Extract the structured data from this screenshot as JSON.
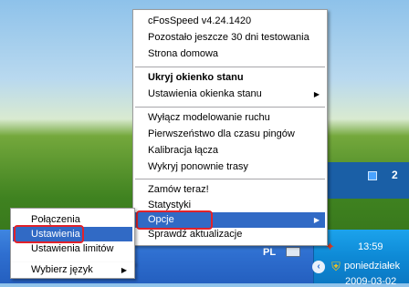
{
  "desktop": {
    "window_count": "2"
  },
  "main_menu": {
    "items": [
      {
        "label": "cFosSpeed v4.24.1420"
      },
      {
        "label": "Pozostało jeszcze 30 dni testowania"
      },
      {
        "label": "Strona domowa"
      },
      {
        "label": "Ukryj okienko stanu"
      },
      {
        "label": "Ustawienia okienka stanu"
      },
      {
        "label": "Wyłącz modelowanie ruchu"
      },
      {
        "label": "Pierwszeństwo dla czasu pingów"
      },
      {
        "label": "Kalibracja łącza"
      },
      {
        "label": "Wykryj ponownie trasy"
      },
      {
        "label": "Zamów teraz!"
      },
      {
        "label": "Statystyki"
      },
      {
        "label": "Opcje"
      },
      {
        "label": "Sprawdź aktualizacje"
      }
    ]
  },
  "sub_menu": {
    "items": [
      {
        "label": "Połączenia"
      },
      {
        "label": "Ustawienia"
      },
      {
        "label": "Ustawienia limitów"
      },
      {
        "label": "Wybierz język"
      }
    ]
  },
  "taskbar": {
    "language": "PL",
    "time": "13:59",
    "day": "poniedziałek",
    "date": "2009-03-02"
  },
  "colors": {
    "highlight": "#316ac5",
    "annotation": "#e2222a"
  }
}
